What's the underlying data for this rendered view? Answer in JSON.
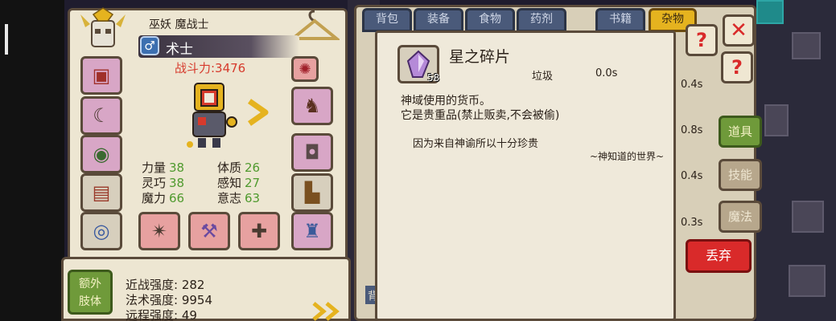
{
  "character": {
    "title": "巫妖 魔战士",
    "class_name": "术士",
    "class_icon": "male-icon",
    "power": "战斗力:3476",
    "stats": [
      {
        "label": "力量",
        "value": "38"
      },
      {
        "label": "体质",
        "value": "26"
      },
      {
        "label": "灵巧",
        "value": "38"
      },
      {
        "label": "感知",
        "value": "27"
      },
      {
        "label": "魔力",
        "value": "66"
      },
      {
        "label": "意志",
        "value": "63"
      }
    ]
  },
  "extra": {
    "button_label": "额外\n肢体",
    "strengths": [
      {
        "label": "近战强度",
        "value": "282"
      },
      {
        "label": "法术强度",
        "value": "9954"
      },
      {
        "label": "远程强度",
        "value": "49"
      }
    ]
  },
  "inventory": {
    "tabs": [
      "背包",
      "装备",
      "食物",
      "药剂",
      "书籍",
      "杂物"
    ],
    "active_tab": "杂物",
    "side_tabs": [
      "道具",
      "技能",
      "魔法"
    ],
    "timers": [
      "0.4s",
      "0.8s",
      "0.4s",
      "0.3s"
    ],
    "discard_label": "丢弃",
    "back_label": "背"
  },
  "tooltip": {
    "item_name": "星之碎片",
    "quantity": "58",
    "item_type": "垃圾",
    "cooldown": "0.0s",
    "desc_line1": "神域使用的货币。",
    "desc_line2": "它是贵重品(禁止贩卖,不会被偷)",
    "quote": "因为来自神谕所以十分珍贵",
    "source": "~神知道的世界~"
  },
  "colors": {
    "panel": "#ede6d2",
    "border": "#5a4a3a",
    "green_value": "#4f9a2e",
    "power_red": "#d63a2c",
    "discard_red": "#d92a2a",
    "gold": "#e5b31f"
  }
}
